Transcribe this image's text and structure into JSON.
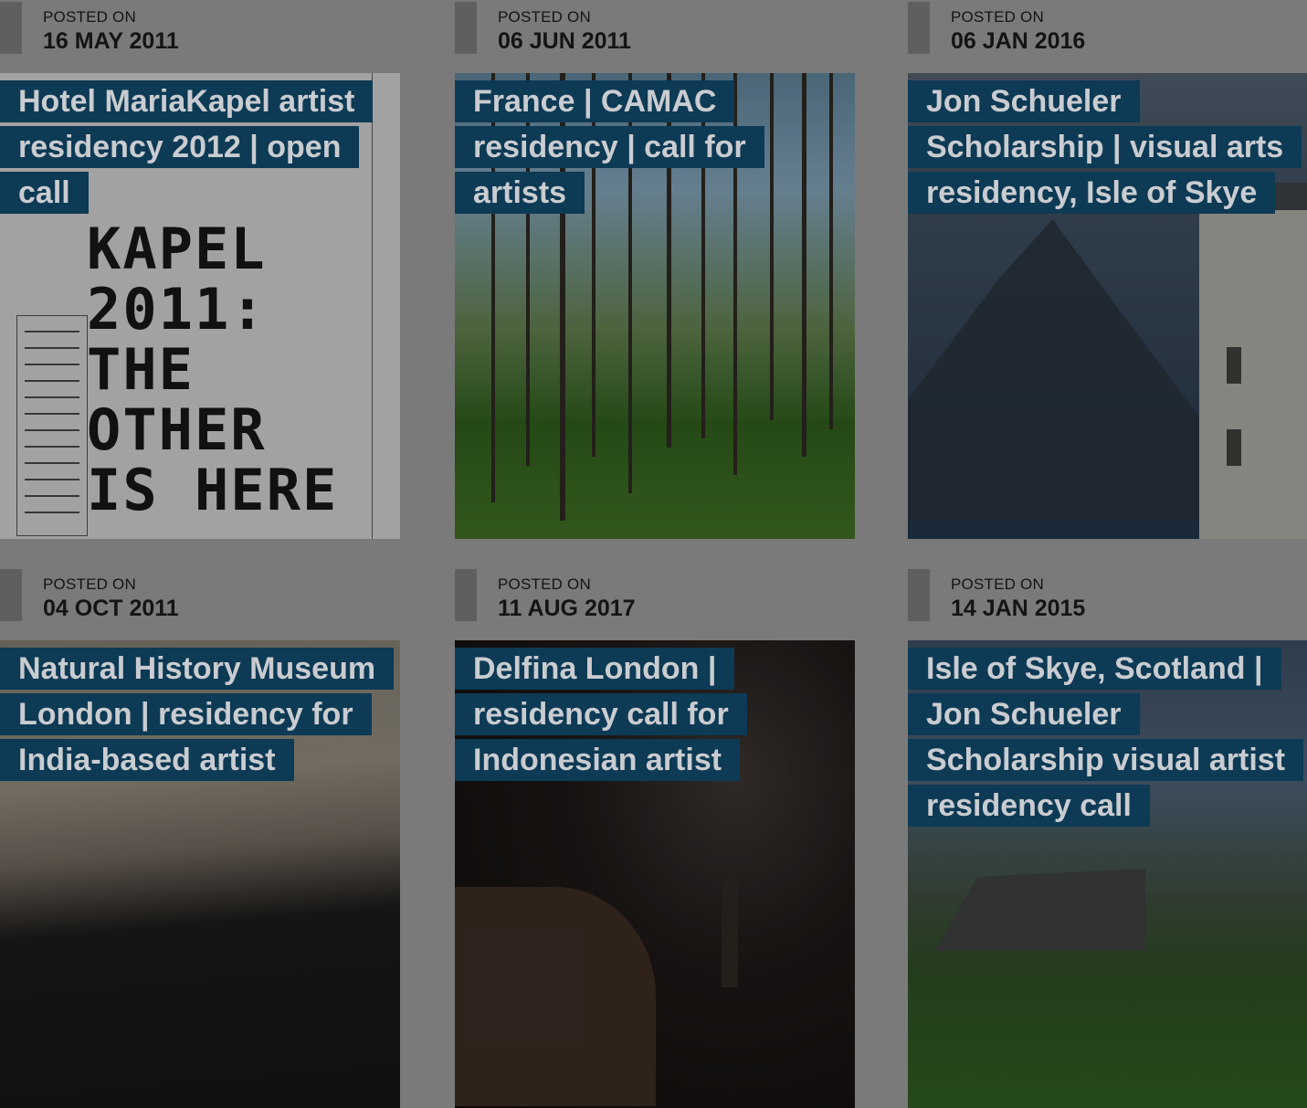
{
  "posted_label": "POSTED ON",
  "cards": [
    {
      "date": "16 MAY 2011",
      "title": "Hotel MariaKapel artist residency 2012 | open call",
      "image": "poster-image",
      "poster_lines": [
        "KAPEL",
        "2011:",
        "THE",
        "OTHER",
        "IS HERE"
      ]
    },
    {
      "date": "06 JUN 2011",
      "title": "France | CAMAC residency | call for artists",
      "image": "forest-image"
    },
    {
      "date": "06 JAN 2016",
      "title": "Jon Schueler Scholarship | visual arts residency, Isle of Skye",
      "image": "isle-of-skye-image"
    },
    {
      "date": "04 OCT 2011",
      "title": "Natural History Museum London | residency for India-based artist",
      "image": "panda-image"
    },
    {
      "date": "11 AUG 2017",
      "title": "Delfina London | residency call for Indonesian artist",
      "image": "gallery-viewer-image"
    },
    {
      "date": "14 JAN 2015",
      "title": "Isle of Skye, Scotland | Jon Schueler Scholarship visual artist residency call",
      "image": "isle-of-skye-image"
    }
  ]
}
